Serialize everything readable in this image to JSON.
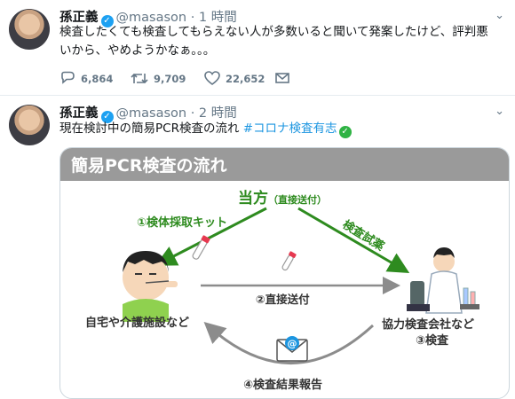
{
  "tweets": [
    {
      "name": "孫正義",
      "handle": "@masason",
      "time": "1 時間",
      "text_line1": "検査したくても検査してもらえない人が多数いると聞いて発案したけど、評判悪",
      "text_line2": "いから、やめようかなぁ。。。",
      "replies": "6,864",
      "retweets": "9,709",
      "likes": "22,652"
    },
    {
      "name": "孫正義",
      "handle": "@masason",
      "time": "2 時間",
      "text": "現在検討中の簡易PCR検査の流れ",
      "hashtag": "#コロナ検査有志"
    }
  ],
  "diagram": {
    "title": "簡易PCR検査の流れ",
    "center_top": "当方",
    "center_top_sub": "（直接送付）",
    "kit_label": "①検体採取キット",
    "sample_label": "検査試薬",
    "direct_label": "②直接送付",
    "home_label": "自宅や介護施設など",
    "lab_label1": "協力検査会社など",
    "lab_label2": "③検査",
    "report_label": "④検査結果報告",
    "colors": {
      "green": "#2e8b1f",
      "arrow_gray": "#8c8c8c",
      "title_bar": "#9a9a9a"
    }
  }
}
